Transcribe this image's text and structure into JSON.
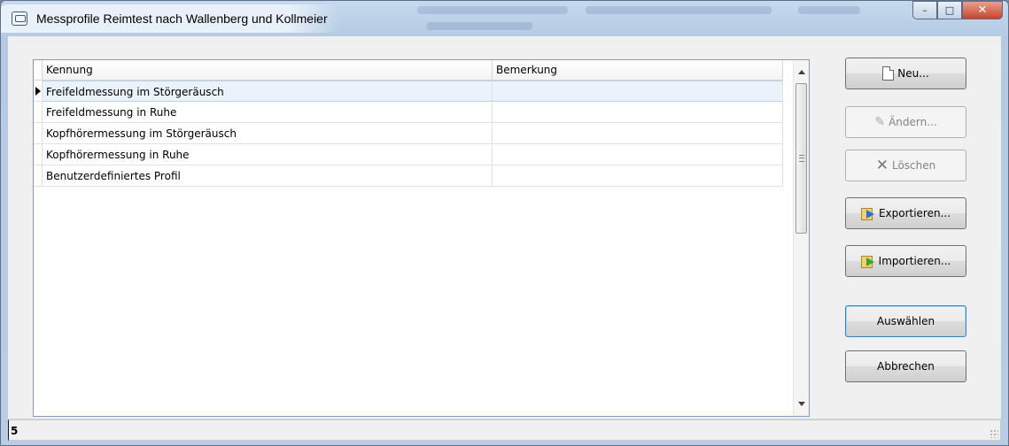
{
  "window": {
    "title": "Messprofile Reimtest nach Wallenberg und Kollmeier",
    "caption": {
      "minimize": "–",
      "maximize": "□",
      "close": "✕"
    }
  },
  "grid": {
    "columns": [
      "Kennung",
      "Bemerkung"
    ],
    "rows": [
      {
        "kennung": "Freifeldmessung im Störgeräusch",
        "bemerkung": ""
      },
      {
        "kennung": "Freifeldmessung in Ruhe",
        "bemerkung": ""
      },
      {
        "kennung": "Kopfhörermessung im Störgeräusch",
        "bemerkung": ""
      },
      {
        "kennung": "Kopfhörermessung in Ruhe",
        "bemerkung": ""
      },
      {
        "kennung": "Benutzerdefiniertes Profil",
        "bemerkung": ""
      }
    ],
    "selected_row": 0
  },
  "buttons": {
    "new": "Neu...",
    "edit": "Ändern...",
    "delete": "Löschen",
    "export": "Exportieren...",
    "import": "Importieren...",
    "select": "Auswählen",
    "cancel": "Abbrechen"
  },
  "status": {
    "count": "5"
  },
  "icons": {
    "window": "window-icon",
    "new": "document-icon",
    "edit": "pencil-icon",
    "delete": "x-icon",
    "export": "export-icon",
    "import": "import-icon"
  }
}
